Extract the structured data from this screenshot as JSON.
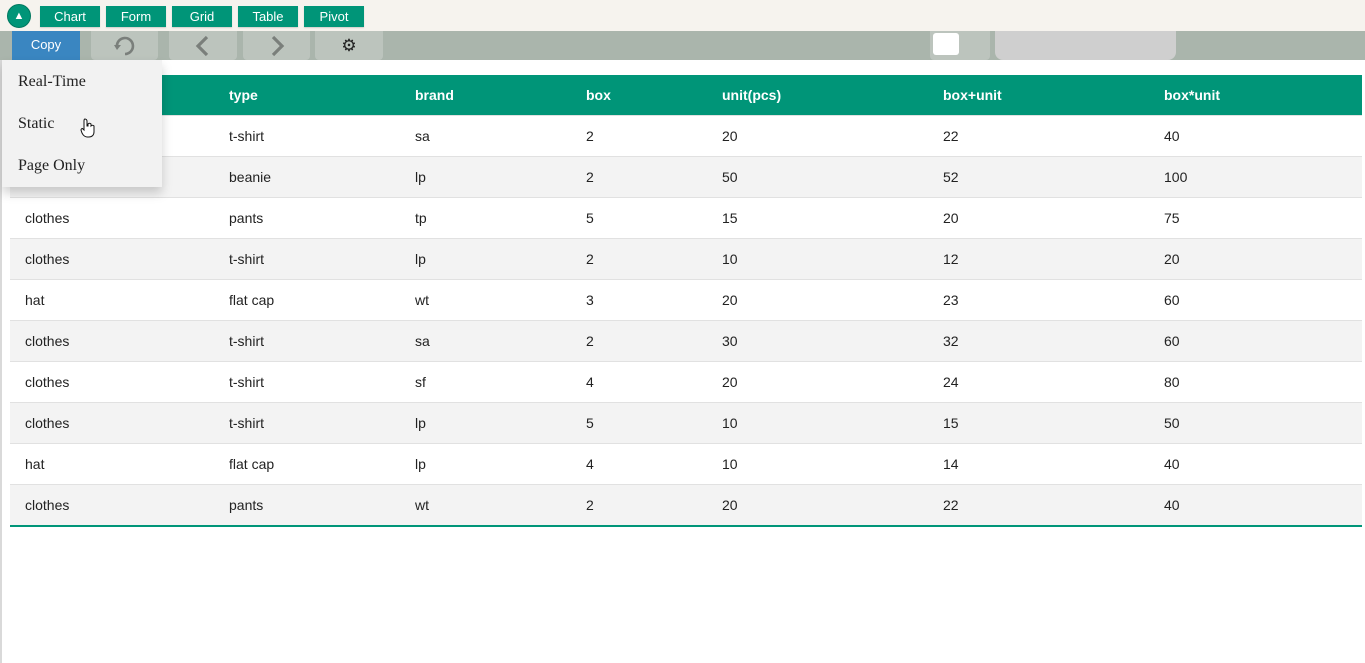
{
  "modebar": {
    "buttons": [
      "Chart",
      "Form",
      "Grid",
      "Table",
      "Pivot"
    ]
  },
  "toolbar": {
    "copy_label": "Copy"
  },
  "copy_menu": {
    "items": [
      "Real-Time",
      "Static",
      "Page Only"
    ]
  },
  "table": {
    "headers": [
      "",
      "type",
      "brand",
      "box",
      "unit(pcs)",
      "box+unit",
      "box*unit"
    ],
    "rows": [
      [
        "",
        "t-shirt",
        "sa",
        "2",
        "20",
        "22",
        "40"
      ],
      [
        "",
        "beanie",
        "lp",
        "2",
        "50",
        "52",
        "100"
      ],
      [
        "clothes",
        "pants",
        "tp",
        "5",
        "15",
        "20",
        "75"
      ],
      [
        "clothes",
        "t-shirt",
        "lp",
        "2",
        "10",
        "12",
        "20"
      ],
      [
        "hat",
        "flat cap",
        "wt",
        "3",
        "20",
        "23",
        "60"
      ],
      [
        "clothes",
        "t-shirt",
        "sa",
        "2",
        "30",
        "32",
        "60"
      ],
      [
        "clothes",
        "t-shirt",
        "sf",
        "4",
        "20",
        "24",
        "80"
      ],
      [
        "clothes",
        "t-shirt",
        "lp",
        "5",
        "10",
        "15",
        "50"
      ],
      [
        "hat",
        "flat cap",
        "lp",
        "4",
        "10",
        "14",
        "40"
      ],
      [
        "clothes",
        "pants",
        "wt",
        "2",
        "20",
        "22",
        "40"
      ]
    ]
  },
  "colors": {
    "accent": "#009578",
    "copy_button": "#3a86c1",
    "toolbar": "#aab5ac"
  },
  "icons": {
    "toggle": "up-triangle-icon",
    "refresh": "refresh-icon",
    "prev": "chevron-left-icon",
    "next": "chevron-right-icon",
    "settings": "gear-icon"
  }
}
